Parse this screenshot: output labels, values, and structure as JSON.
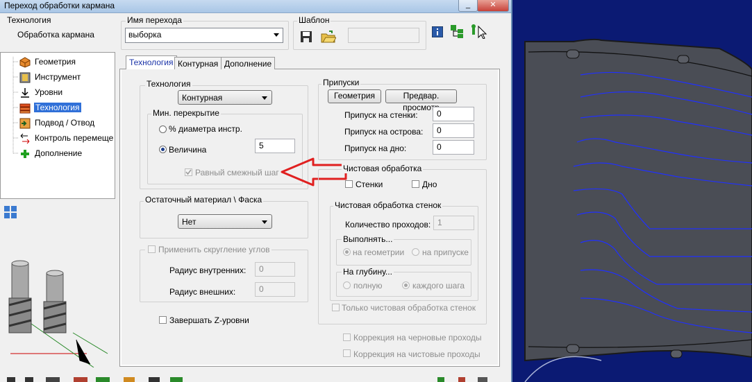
{
  "window": {
    "title": "Переход обработки кармана"
  },
  "top": {
    "technology_label": "Технология",
    "technology_value": "Обработка кармана",
    "transition_name_label": "Имя перехода",
    "transition_name_value": "выборка",
    "template_label": "Шаблон"
  },
  "tree": {
    "items": [
      {
        "label": "Геометрия"
      },
      {
        "label": "Инструмент"
      },
      {
        "label": "Уровни"
      },
      {
        "label": "Технология"
      },
      {
        "label": "Подвод / Отвод"
      },
      {
        "label": "Контроль перемеще"
      },
      {
        "label": "Дополнение"
      }
    ],
    "selected_index": 3
  },
  "tabs": [
    {
      "label": "Технология",
      "active": true
    },
    {
      "label": "Контурная",
      "active": false
    },
    {
      "label": "Дополнение",
      "active": false
    }
  ],
  "tech_group": {
    "legend": "Технология",
    "strategy_value": "Контурная",
    "overlap_legend": "Мин. перекрытие",
    "percent_label": "% диаметра инстр.",
    "value_label": "Величина",
    "value": "5",
    "equal_step_label": "Равный смежный шаг"
  },
  "residual_group": {
    "legend": "Остаточный материал \\ Фаска",
    "value": "Нет"
  },
  "rounding_group": {
    "legend": "Применить скругление углов",
    "inner_label": "Радиус внутренних:",
    "inner_value": "0",
    "outer_label": "Радиус внешних:",
    "outer_value": "0"
  },
  "finish_z_label": "Завершать Z-уровни",
  "allowance_group": {
    "legend": "Припуски",
    "geometry_button": "Геометрия",
    "preview_button": "Предвар. просмотр",
    "walls_label": "Припуск на стенки:",
    "walls_value": "0",
    "islands_label": "Припуск на острова:",
    "islands_value": "0",
    "bottom_label": "Припуск на дно:",
    "bottom_value": "0"
  },
  "finishing_group": {
    "legend": "Чистовая обработка",
    "walls_label": "Стенки",
    "bottom_label": "Дно",
    "wall_finish_legend": "Чистовая обработка стенок",
    "passes_label": "Количество проходов:",
    "passes_value": "1",
    "perform_legend": "Выполнять...",
    "on_geometry_label": "на геометрии",
    "on_allowance_label": "на припуске",
    "depth_legend": "На глубину...",
    "full_label": "полную",
    "each_step_label": "каждого шага",
    "only_wall_finish_label": "Только чистовая обработка стенок"
  },
  "correction_rough_label": "Коррекция на черновые проходы",
  "correction_finish_label": "Коррекция на чистовые проходы",
  "colors": {
    "accent": "#1a33a8",
    "arrow": "#e02020",
    "cad_bg": "#0b1a73",
    "toolpath": "#1f2cff"
  }
}
